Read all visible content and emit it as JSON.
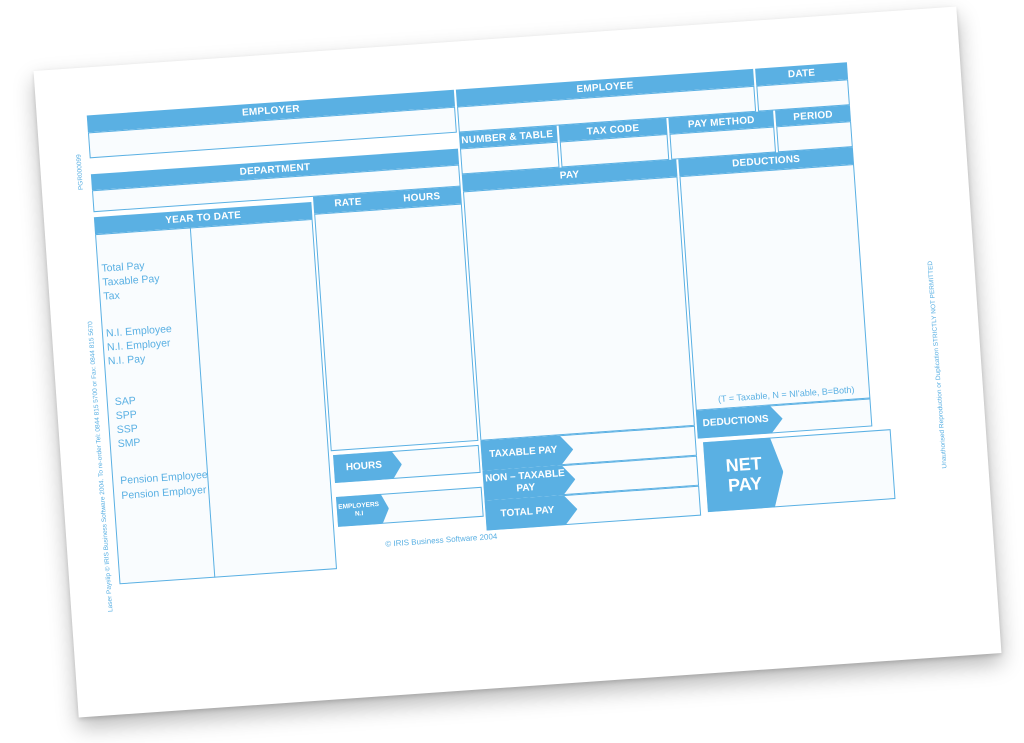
{
  "header": {
    "employer": "EMPLOYER",
    "employee": "EMPLOYEE",
    "date": "DATE",
    "period": "PERIOD",
    "department": "DEPARTMENT",
    "ni_number_table": "N.I. NUMBER & TABLE",
    "tax_code": "TAX CODE",
    "pay_method": "PAY METHOD"
  },
  "columns": {
    "year_to_date": "YEAR TO DATE",
    "rate": "RATE",
    "hours": "HOURS",
    "pay": "PAY",
    "deductions": "DEDUCTIONS"
  },
  "ytd_labels": [
    "Total Pay",
    "Taxable Pay",
    "Tax",
    "N.I. Employee",
    "N.I. Employer",
    "N.I. Pay",
    "SAP",
    "SPP",
    "SSP",
    "SMP",
    "Pension Employee",
    "Pension Employer"
  ],
  "totals": {
    "hours": "HOURS",
    "employers_ni": "EMPLOYERS N.I",
    "taxable_pay": "TAXABLE PAY",
    "non_taxable_pay": "NON – TAXABLE PAY",
    "total_pay": "TOTAL PAY",
    "deductions": "DEDUCTIONS",
    "net_pay": "NET PAY"
  },
  "note": "(T = Taxable, N = NI'able, B=Both)",
  "copyright": "© IRIS Business Software 2004",
  "side_text": {
    "form_code": "PGR000099",
    "reorder": "Laser Payslip © IRIS Business Software 2004. To re-order Tel: 0844 815 5700 or Fax: 0844 815 5670",
    "warning": "Unauthorised Reproduction or Duplication STRICTLY NOT PERMITTED"
  },
  "colors": {
    "accent": "#5ab0e3",
    "paper": "#ffffff"
  }
}
